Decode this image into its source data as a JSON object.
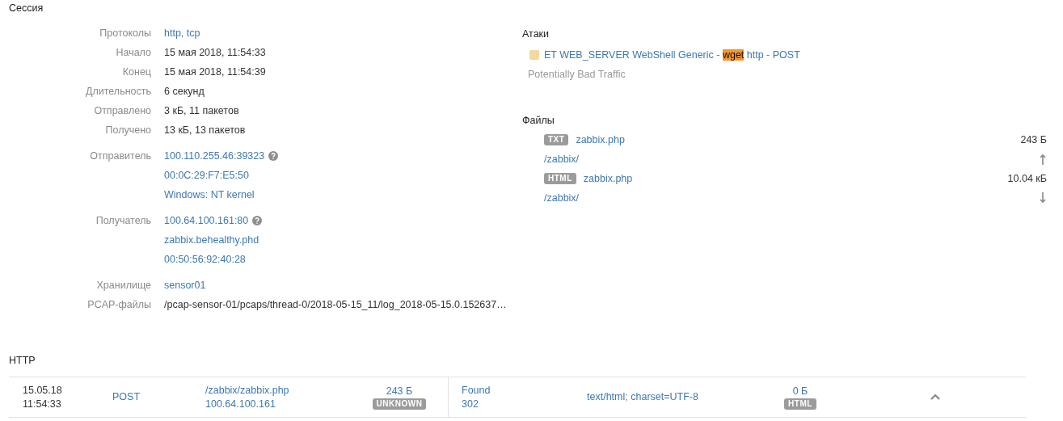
{
  "session": {
    "title": "Сессия",
    "groups": [
      [
        {
          "label": "Протоколы",
          "values": [
            {
              "text": "http, tcp",
              "kind": "link",
              "help": false
            }
          ]
        },
        {
          "label": "Начало",
          "values": [
            {
              "text": "15 мая 2018, 11:54:33",
              "kind": "plain",
              "help": false
            }
          ]
        },
        {
          "label": "Конец",
          "values": [
            {
              "text": "15 мая 2018, 11:54:39",
              "kind": "plain",
              "help": false
            }
          ]
        },
        {
          "label": "Длительность",
          "values": [
            {
              "text": "6 секунд",
              "kind": "plain",
              "help": false
            }
          ]
        },
        {
          "label": "Отправлено",
          "values": [
            {
              "text": "3 кБ, 11 пакетов",
              "kind": "plain",
              "help": false
            }
          ]
        },
        {
          "label": "Получено",
          "values": [
            {
              "text": "13 кБ, 13 пакетов",
              "kind": "plain",
              "help": false
            }
          ]
        }
      ],
      [
        {
          "label": "Отправитель",
          "values": [
            {
              "text": "100.110.255.46:39323",
              "kind": "link",
              "help": true
            },
            {
              "text": "00:0C:29:F7:E5:50",
              "kind": "link",
              "help": false
            },
            {
              "text": "Windows: NT kernel",
              "kind": "link",
              "help": false
            }
          ]
        }
      ],
      [
        {
          "label": "Получатель",
          "values": [
            {
              "text": "100.64.100.161:80",
              "kind": "link",
              "help": true
            },
            {
              "text": "zabbix.behealthy.phd",
              "kind": "link",
              "help": false
            },
            {
              "text": "00:50:56:92:40:28",
              "kind": "link",
              "help": false
            }
          ]
        }
      ],
      [
        {
          "label": "Хранилище",
          "values": [
            {
              "text": "sensor01",
              "kind": "link",
              "help": false
            }
          ]
        },
        {
          "label": "PCAP-файлы",
          "values": [
            {
              "text": "/pcap-sensor-01/pcaps/thread-0/2018-05-15_11/log_2018-05-15.0.152637…",
              "kind": "plain",
              "help": false
            }
          ]
        }
      ]
    ]
  },
  "attacks": {
    "title": "Атаки",
    "items": [
      {
        "color": "#f2d9a0",
        "name_before": "ET WEB_SERVER WebShell Generic - ",
        "highlight": "wget",
        "name_after": " http - POST",
        "category": "Potentially Bad Traffic"
      }
    ]
  },
  "files": {
    "title": "Файлы",
    "items": [
      {
        "type": "TXT",
        "name": "zabbix.php",
        "size": "243 Б",
        "path": "/zabbix/",
        "outgoing": true
      },
      {
        "type": "HTML",
        "name": "zabbix.php",
        "size": "10.04 кБ",
        "path": "/zabbix/",
        "outgoing": false
      }
    ]
  },
  "http": {
    "title": "HTTP",
    "rows": [
      {
        "date": "15.05.18",
        "time": "11:54:33",
        "method": "POST",
        "path": "/zabbix/zabbix.php",
        "host": "100.64.100.161",
        "request_size": "243 Б",
        "request_type": "UNKNOWN",
        "status_text": "Found",
        "status_code": "302",
        "content_type": "text/html; charset=UTF-8",
        "response_size": "0 Б",
        "response_type": "HTML",
        "expanded": true
      }
    ]
  }
}
